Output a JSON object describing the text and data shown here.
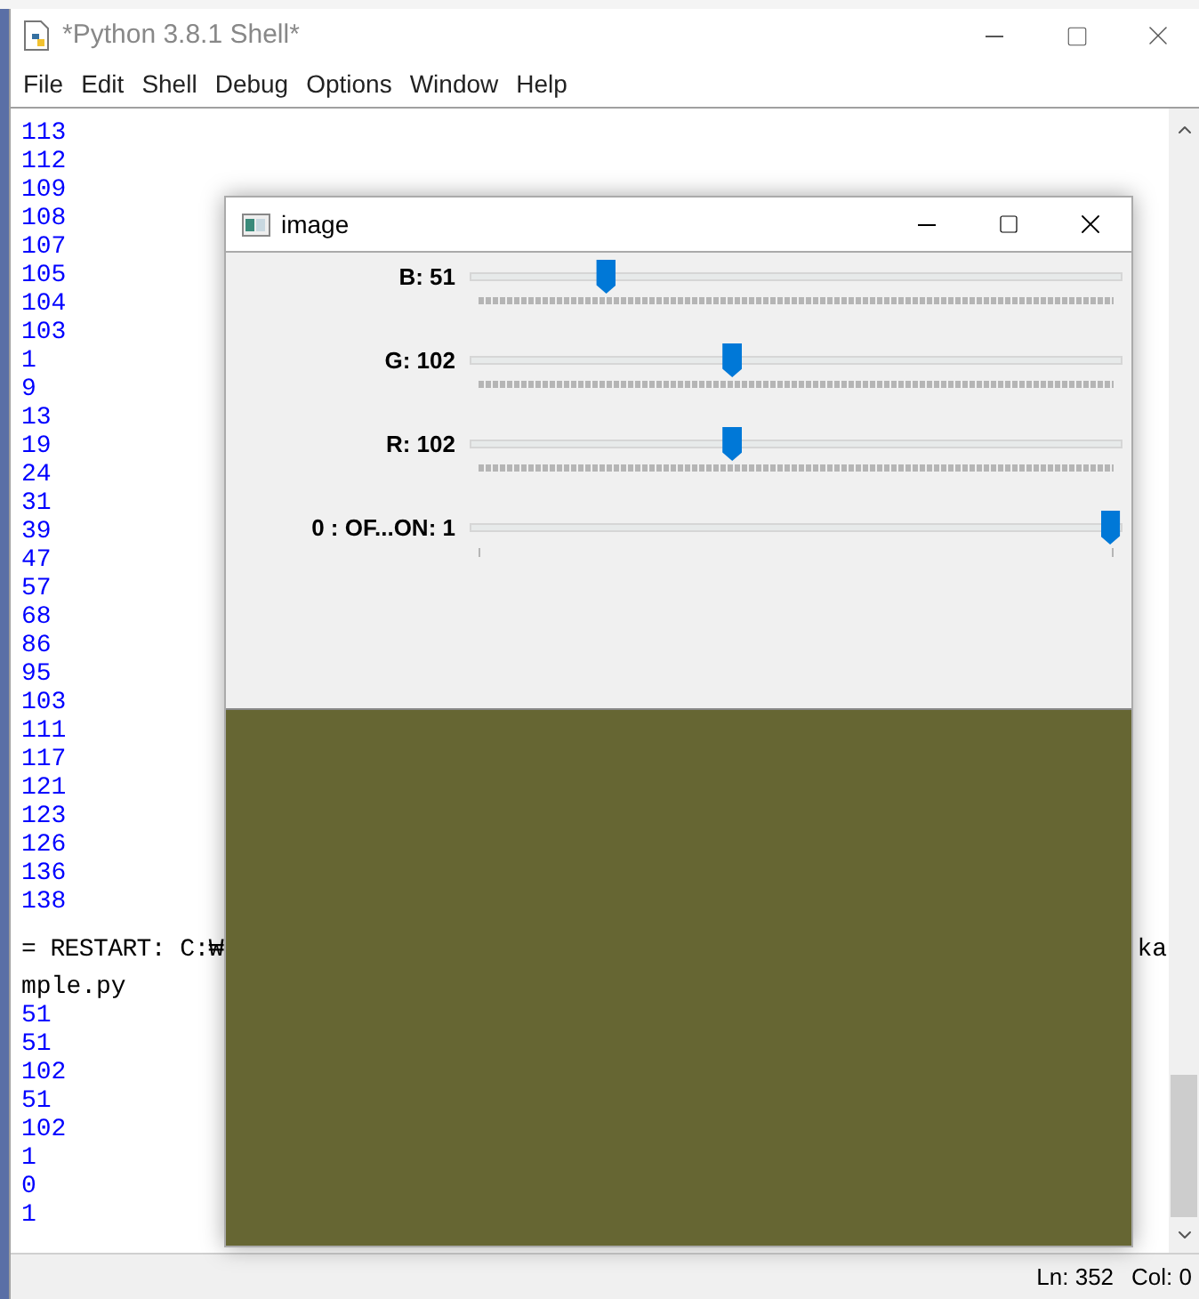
{
  "shell_window": {
    "title": "*Python 3.8.1 Shell*"
  },
  "menu": [
    "File",
    "Edit",
    "Shell",
    "Debug",
    "Options",
    "Window",
    "Help"
  ],
  "shell_lines": [
    {
      "kind": "output",
      "text": "113"
    },
    {
      "kind": "output",
      "text": "112"
    },
    {
      "kind": "output",
      "text": "109"
    },
    {
      "kind": "output",
      "text": "108"
    },
    {
      "kind": "output",
      "text": "107"
    },
    {
      "kind": "output",
      "text": "105"
    },
    {
      "kind": "output",
      "text": "104"
    },
    {
      "kind": "output",
      "text": "103"
    },
    {
      "kind": "output",
      "text": "1"
    },
    {
      "kind": "output",
      "text": "9"
    },
    {
      "kind": "output",
      "text": "13"
    },
    {
      "kind": "output",
      "text": "19"
    },
    {
      "kind": "output",
      "text": "24"
    },
    {
      "kind": "output",
      "text": "31"
    },
    {
      "kind": "output",
      "text": "39"
    },
    {
      "kind": "output",
      "text": "47"
    },
    {
      "kind": "output",
      "text": "57"
    },
    {
      "kind": "output",
      "text": "68"
    },
    {
      "kind": "output",
      "text": "86"
    },
    {
      "kind": "output",
      "text": "95"
    },
    {
      "kind": "output",
      "text": "103"
    },
    {
      "kind": "output",
      "text": "111"
    },
    {
      "kind": "output",
      "text": "117"
    },
    {
      "kind": "output",
      "text": "121"
    },
    {
      "kind": "output",
      "text": "123"
    },
    {
      "kind": "output",
      "text": "126"
    },
    {
      "kind": "output",
      "text": "136"
    },
    {
      "kind": "output",
      "text": "138"
    },
    {
      "kind": "blank"
    },
    {
      "kind": "restart",
      "text": "= RESTART: C:₩",
      "tail": "ka"
    },
    {
      "kind": "text",
      "text": "mple.py"
    },
    {
      "kind": "output",
      "text": "51"
    },
    {
      "kind": "output",
      "text": "51"
    },
    {
      "kind": "output",
      "text": "102"
    },
    {
      "kind": "output",
      "text": "51"
    },
    {
      "kind": "output",
      "text": "102"
    },
    {
      "kind": "output",
      "text": "1"
    },
    {
      "kind": "output",
      "text": "0"
    },
    {
      "kind": "output",
      "text": "1"
    }
  ],
  "status_bar": {
    "line": "Ln: 352",
    "column": "Col: 0"
  },
  "image_window": {
    "title": "image",
    "trackbars": [
      {
        "kind": "slider",
        "label": "B: 51",
        "level": 0.2
      },
      {
        "kind": "slider",
        "label": "G: 102",
        "level": 0.4
      },
      {
        "kind": "slider",
        "label": "R: 102",
        "level": 0.4
      },
      {
        "kind": "switch",
        "label": "0 : OF...ON: 1",
        "level": 1
      }
    ]
  }
}
